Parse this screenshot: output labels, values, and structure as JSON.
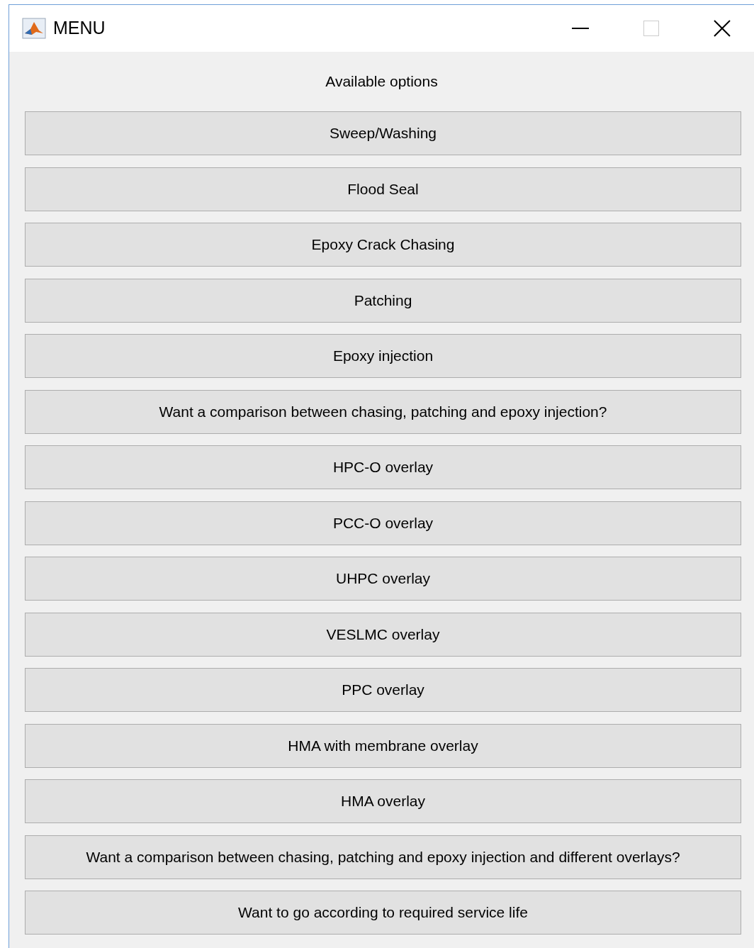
{
  "window": {
    "title": "MENU",
    "maximize_enabled": false
  },
  "heading": "Available options",
  "buttons": [
    "Sweep/Washing",
    "Flood Seal",
    "Epoxy Crack Chasing",
    "Patching",
    "Epoxy injection",
    "Want a comparison between chasing, patching and epoxy injection?",
    "HPC-O overlay",
    "PCC-O overlay",
    "UHPC overlay",
    "VESLMC overlay",
    "PPC overlay",
    "HMA with membrane overlay",
    "HMA overlay",
    "Want a comparison between chasing, patching and epoxy injection and different overlays?",
    "Want to go according to required service life"
  ]
}
